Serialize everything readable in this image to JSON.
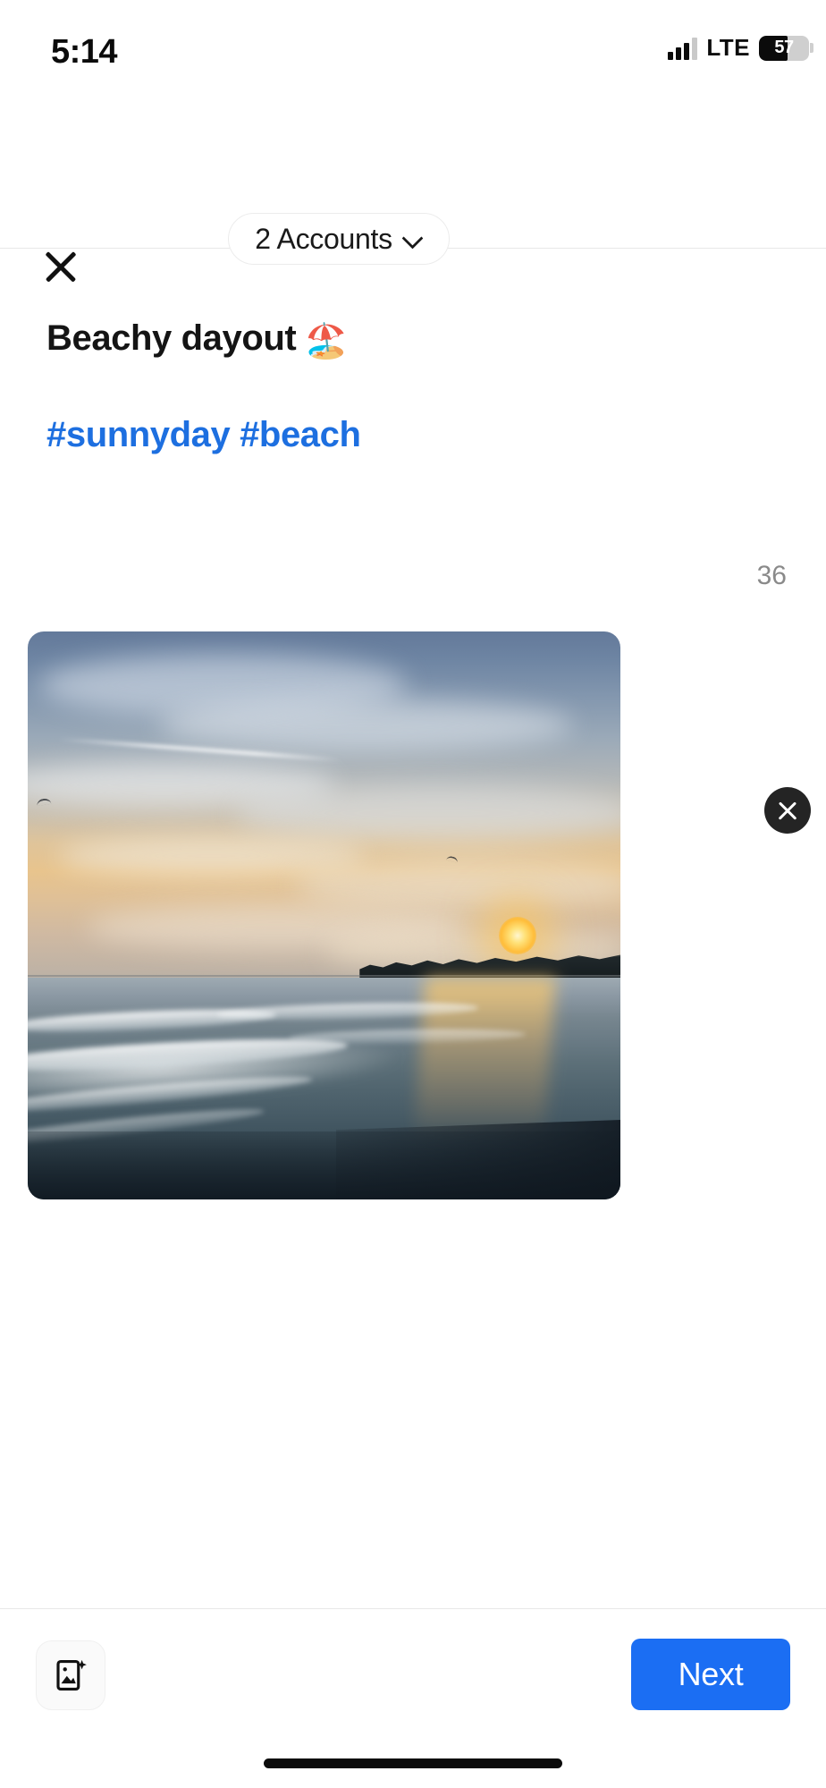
{
  "status_bar": {
    "time": "5:14",
    "network_label": "LTE",
    "battery_percent": "57",
    "signal_icon": "cellular-signal-icon",
    "battery_icon": "battery-icon"
  },
  "header": {
    "close_icon": "close-icon",
    "accounts_label": "2 Accounts",
    "accounts_chevron_icon": "chevron-down-icon"
  },
  "composer": {
    "caption_title": "Beachy dayout",
    "caption_emoji": "🏖️",
    "caption_hashtags": "#sunnyday #beach",
    "char_count": "36",
    "hashtag_color": "#1d6fe0"
  },
  "media": {
    "remove_icon": "close-icon",
    "alt": "beach-sunset-photo"
  },
  "bottom_bar": {
    "add_media_icon": "add-image-icon",
    "next_label": "Next",
    "next_color": "#1b6ef3",
    "home_indicator": "home-indicator"
  }
}
